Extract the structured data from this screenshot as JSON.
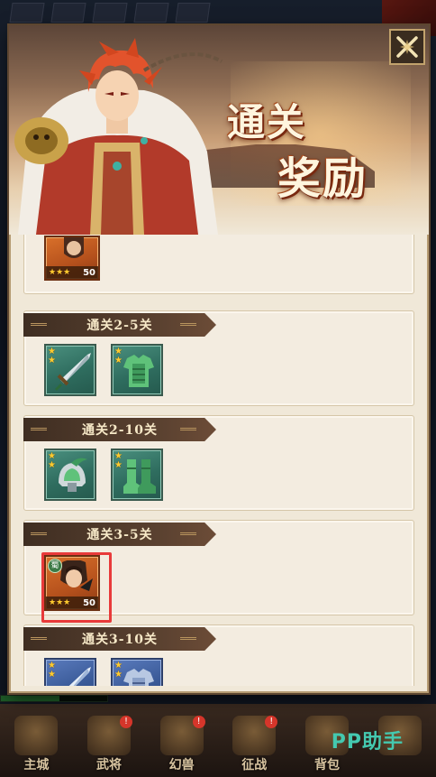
{
  "modal": {
    "title_line1": "通关",
    "title_line2": "奖励"
  },
  "rewards": [
    {
      "stage": "",
      "items": [
        {
          "kind": "hero",
          "level": "50",
          "stars": 3
        }
      ]
    },
    {
      "stage": "通关2-5关",
      "items": [
        {
          "kind": "sword-icon",
          "stars": 2,
          "tier": "green"
        },
        {
          "kind": "armor-icon",
          "stars": 2,
          "tier": "green"
        }
      ]
    },
    {
      "stage": "通关2-10关",
      "items": [
        {
          "kind": "helmet-icon",
          "stars": 2,
          "tier": "green"
        },
        {
          "kind": "boots-icon",
          "stars": 2,
          "tier": "green"
        }
      ]
    },
    {
      "stage": "通关3-5关",
      "items": [
        {
          "kind": "hero",
          "faction": "蜀",
          "level": "50",
          "stars": 3,
          "selected": true
        }
      ]
    },
    {
      "stage": "通关3-10关",
      "items": [
        {
          "kind": "sword-icon",
          "stars": 2,
          "tier": "blue"
        },
        {
          "kind": "armor-icon",
          "stars": 2,
          "tier": "blue"
        }
      ]
    }
  ],
  "bottom_nav": [
    {
      "label": "主城",
      "badge": ""
    },
    {
      "label": "武将",
      "badge": "!"
    },
    {
      "label": "幻兽",
      "badge": "!"
    },
    {
      "label": "征战",
      "badge": "!"
    },
    {
      "label": "背包",
      "badge": ""
    },
    {
      "label": "",
      "badge": ""
    }
  ],
  "watermark": "PP助手",
  "xp_fraction": 0.55,
  "colors": {
    "accent_red": "#e83a3a",
    "header_brown": "#4a3526",
    "star_gold": "#ffcb2f",
    "green_tier": "#2f6d5f",
    "blue_tier": "#3a5a98"
  }
}
